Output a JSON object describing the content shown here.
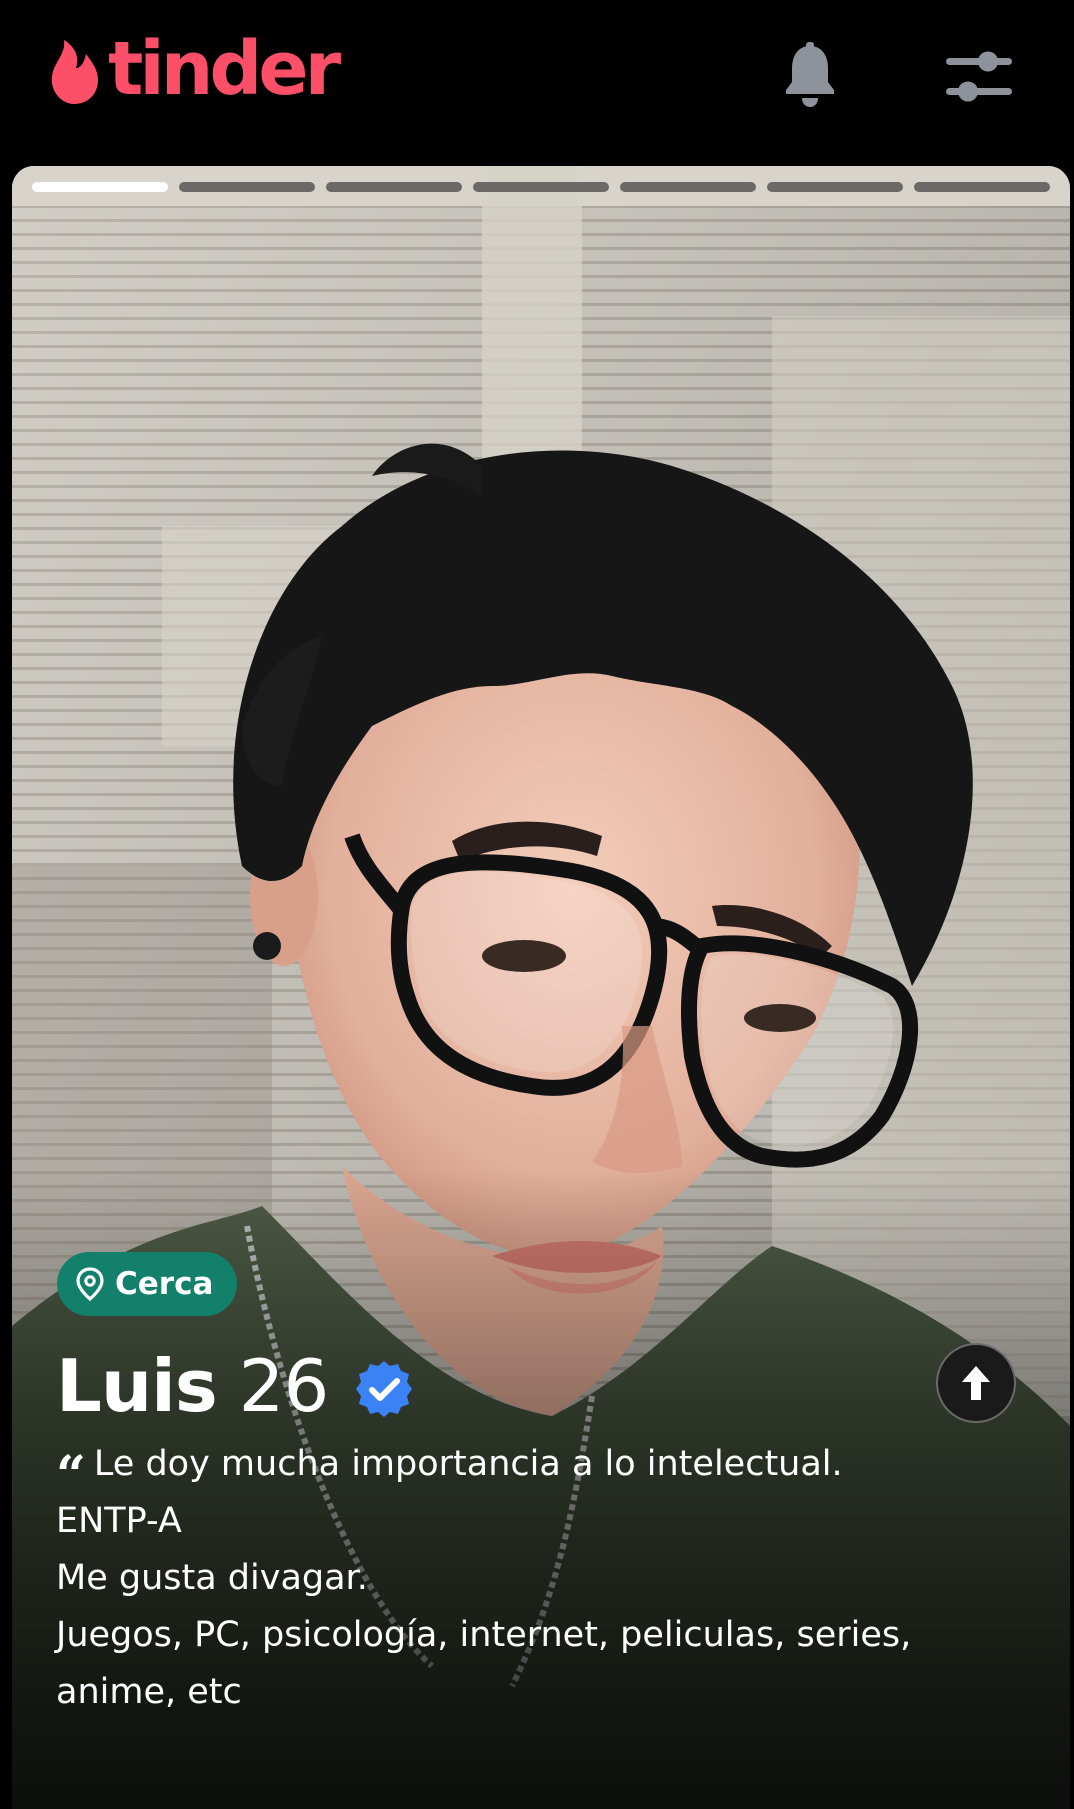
{
  "app": {
    "logo_text": "tinder",
    "brand_color": "#fd5068"
  },
  "header": {
    "notifications_icon": "bell-icon",
    "filters_icon": "sliders-icon"
  },
  "card": {
    "photo_count": 7,
    "active_photo_index": 0,
    "distance_badge": "Cerca",
    "distance_badge_color": "#13806b",
    "name": "Luis",
    "age": "26",
    "verified": true,
    "verified_color": "#3b82f6",
    "bio_lines": [
      "Le doy mucha importancia a lo intelectual.",
      "ENTP-A",
      "Me gusta divagar.",
      "Juegos, PC, psicología, internet, peliculas, series,",
      "anime, etc"
    ]
  }
}
